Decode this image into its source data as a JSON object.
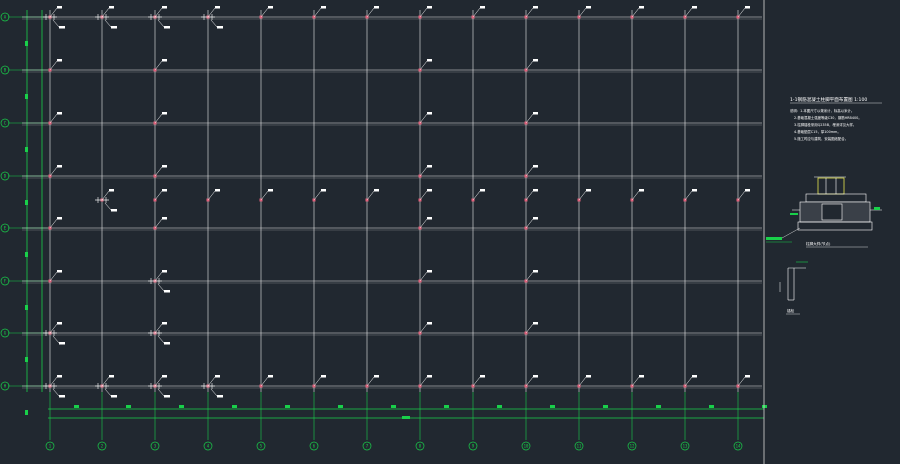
{
  "drawing": {
    "background_color": "#212830",
    "grid_color": "#e9e9e9",
    "axis_color": "#19d04a",
    "marker_color": "#e0607a",
    "sheet_border_color": "#d8d8d8"
  },
  "column_axes": {
    "labels": [
      "1",
      "2",
      "3",
      "4",
      "5",
      "6",
      "7",
      "8",
      "9",
      "10",
      "11",
      "12",
      "13",
      "14"
    ]
  },
  "row_axes": {
    "labels": [
      "A",
      "B",
      "C",
      "D",
      "E",
      "F",
      "G",
      "H"
    ]
  },
  "notes": {
    "title": "1-1钢筋混凝土柱脚平面布置图  1:100",
    "lines": [
      "说明：1.本图尺寸以毫米计，标高以米计。",
      "2.基础混凝土强度等级C30，钢筋HRB400。",
      "3.柱脚锚栓采用Q235B，埋深详见大样。",
      "4.基础垫层C15，厚100mm。",
      "5.施工时应与建筑、安装图纸配合。"
    ]
  },
  "details": {
    "section_caption": "柱脚大样(节点)",
    "small_caption": "锚栓"
  }
}
